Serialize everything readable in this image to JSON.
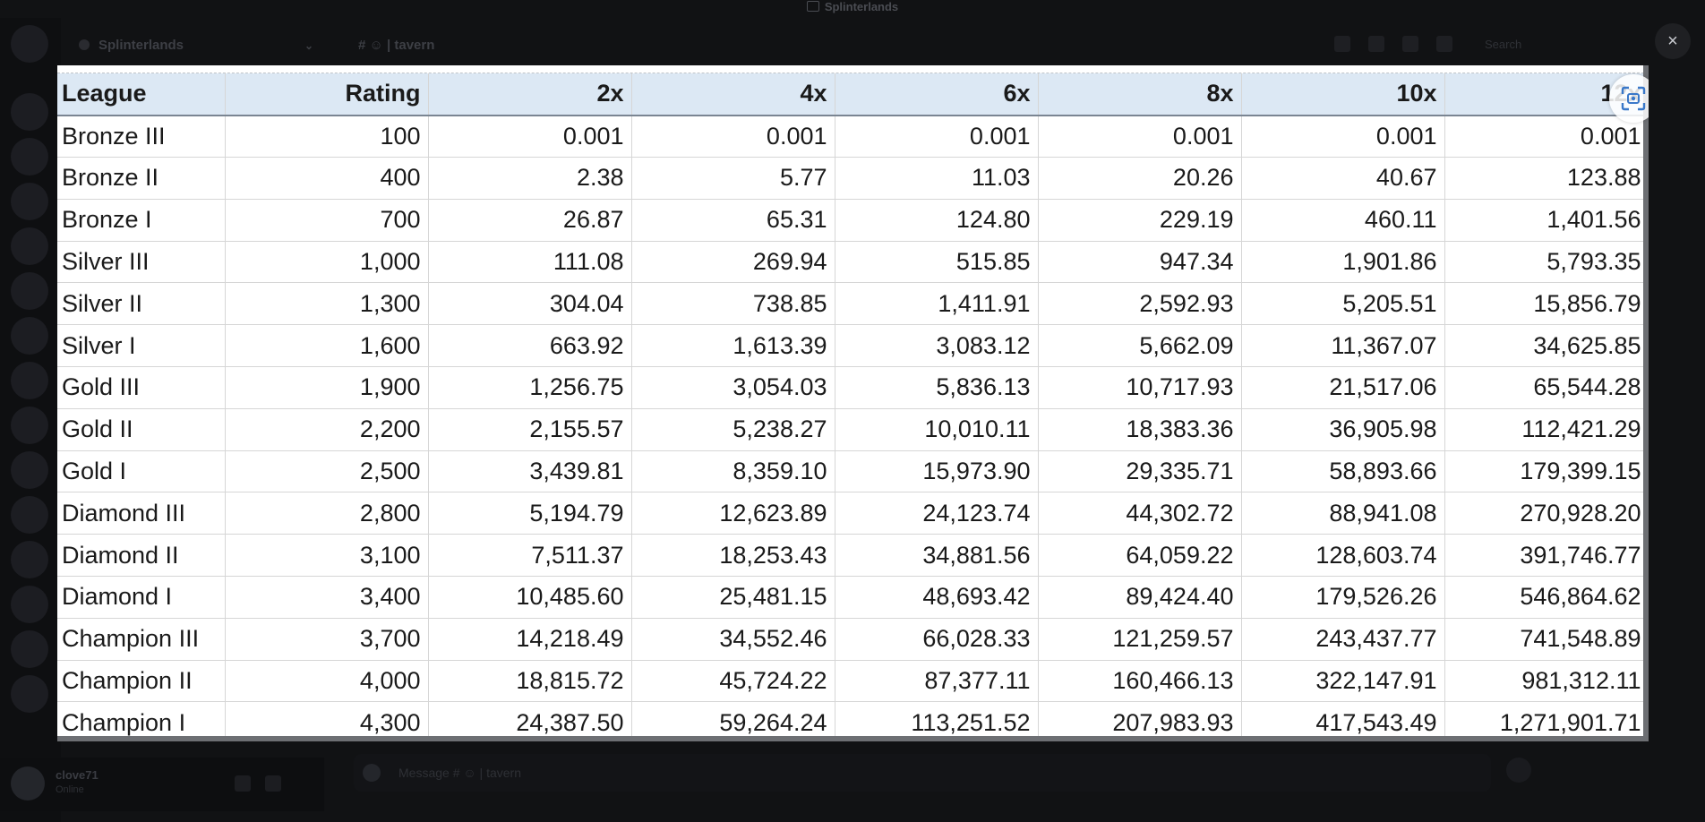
{
  "window": {
    "title": "Splinterlands"
  },
  "backdrop": {
    "server_name": "Splinterlands",
    "channel_name": "# ☺ | tavern",
    "search_placeholder": "Search",
    "user": {
      "name": "clove71",
      "status": "Online"
    },
    "composer_placeholder": "Message # ☺ | tavern"
  },
  "viewer": {
    "close_label": "×",
    "scan_icon": "scan-text-icon"
  },
  "table": {
    "headers": [
      "League",
      "Rating",
      "2x",
      "4x",
      "6x",
      "8x",
      "10x",
      "12x"
    ],
    "rows": [
      [
        "Bronze III",
        "100",
        "0.001",
        "0.001",
        "0.001",
        "0.001",
        "0.001",
        "0.001"
      ],
      [
        "Bronze II",
        "400",
        "2.38",
        "5.77",
        "11.03",
        "20.26",
        "40.67",
        "123.88"
      ],
      [
        "Bronze I",
        "700",
        "26.87",
        "65.31",
        "124.80",
        "229.19",
        "460.11",
        "1,401.56"
      ],
      [
        "Silver III",
        "1,000",
        "111.08",
        "269.94",
        "515.85",
        "947.34",
        "1,901.86",
        "5,793.35"
      ],
      [
        "Silver II",
        "1,300",
        "304.04",
        "738.85",
        "1,411.91",
        "2,592.93",
        "5,205.51",
        "15,856.79"
      ],
      [
        "Silver I",
        "1,600",
        "663.92",
        "1,613.39",
        "3,083.12",
        "5,662.09",
        "11,367.07",
        "34,625.85"
      ],
      [
        "Gold III",
        "1,900",
        "1,256.75",
        "3,054.03",
        "5,836.13",
        "10,717.93",
        "21,517.06",
        "65,544.28"
      ],
      [
        "Gold II",
        "2,200",
        "2,155.57",
        "5,238.27",
        "10,010.11",
        "18,383.36",
        "36,905.98",
        "112,421.29"
      ],
      [
        "Gold I",
        "2,500",
        "3,439.81",
        "8,359.10",
        "15,973.90",
        "29,335.71",
        "58,893.66",
        "179,399.15"
      ],
      [
        "Diamond III",
        "2,800",
        "5,194.79",
        "12,623.89",
        "24,123.74",
        "44,302.72",
        "88,941.08",
        "270,928.20"
      ],
      [
        "Diamond II",
        "3,100",
        "7,511.37",
        "18,253.43",
        "34,881.56",
        "64,059.22",
        "128,603.74",
        "391,746.77"
      ],
      [
        "Diamond I",
        "3,400",
        "10,485.60",
        "25,481.15",
        "48,693.42",
        "89,424.40",
        "179,526.26",
        "546,864.62"
      ],
      [
        "Champion III",
        "3,700",
        "14,218.49",
        "34,552.46",
        "66,028.33",
        "121,259.57",
        "243,437.77",
        "741,548.89"
      ],
      [
        "Champion II",
        "4,000",
        "18,815.72",
        "45,724.22",
        "87,377.11",
        "160,466.13",
        "322,147.91",
        "981,312.11"
      ],
      [
        "Champion I",
        "4,300",
        "24,387.50",
        "59,264.24",
        "113,251.52",
        "207,983.93",
        "417,543.49",
        "1,271,901.71"
      ]
    ]
  }
}
